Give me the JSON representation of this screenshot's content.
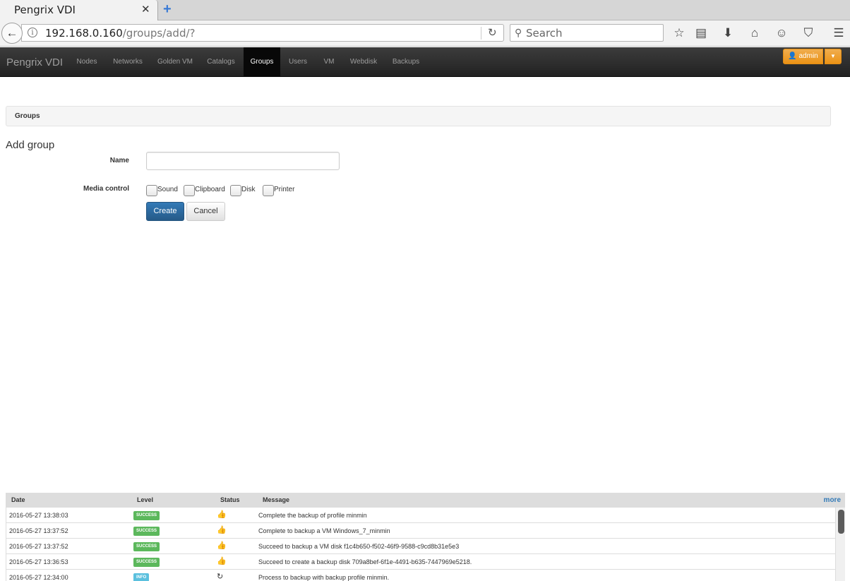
{
  "browser": {
    "tab_title": "Pengrix VDI",
    "tab_close": "✕",
    "new_tab": "+",
    "url_host": "192.168.0.160",
    "url_path": "/groups/add/?",
    "search_placeholder": "Search"
  },
  "app": {
    "brand": "Pengrix VDI",
    "nav": [
      "Nodes",
      "Networks",
      "Golden VM",
      "Catalogs",
      "Groups",
      "Users",
      "VM",
      "Webdisk",
      "Backups"
    ],
    "active_nav": "Groups",
    "user_label": "admin"
  },
  "breadcrumb": "Groups",
  "form": {
    "title": "Add group",
    "name_label": "Name",
    "name_value": "",
    "media_label": "Media control",
    "media_options": [
      "Sound",
      "Clipboard",
      "Disk",
      "Printer"
    ],
    "create_label": "Create",
    "cancel_label": "Cancel"
  },
  "log": {
    "headers": {
      "date": "Date",
      "level": "Level",
      "status": "Status",
      "message": "Message"
    },
    "more": "more",
    "level_colors": {
      "SUCCESS": "#5cb85c",
      "INFO": "#5bc0de"
    },
    "rows": [
      {
        "date": "2016-05-27 13:38:03",
        "level": "SUCCESS",
        "status_icon": "thumbs-up-icon",
        "message": "Complete the backup of profile minmin"
      },
      {
        "date": "2016-05-27 13:37:52",
        "level": "SUCCESS",
        "status_icon": "thumbs-up-icon",
        "message": "Complete to backup a VM Windows_7_minmin"
      },
      {
        "date": "2016-05-27 13:37:52",
        "level": "SUCCESS",
        "status_icon": "thumbs-up-icon",
        "message": "Succeed to backup a VM disk f1c4b650-f502-46f9-9588-c9cd8b31e5e3"
      },
      {
        "date": "2016-05-27 13:36:53",
        "level": "SUCCESS",
        "status_icon": "thumbs-up-icon",
        "message": "Succeed to create a backup disk 709a8bef-6f1e-4491-b635-7447969e5218."
      },
      {
        "date": "2016-05-27 12:34:00",
        "level": "INFO",
        "status_icon": "refresh-icon",
        "message": "Process to backup with backup profile minmin."
      }
    ]
  }
}
